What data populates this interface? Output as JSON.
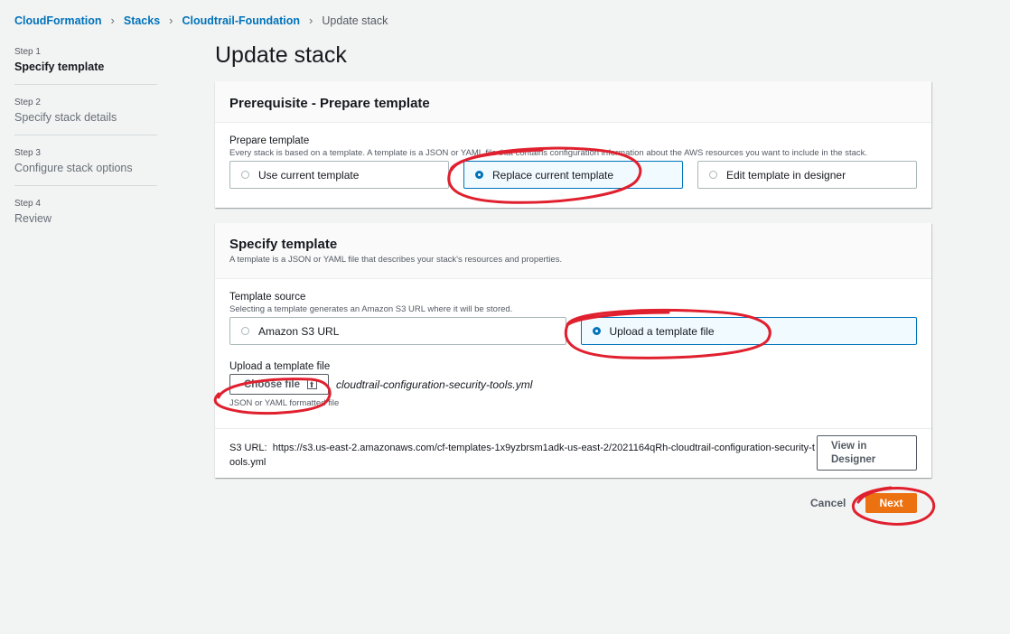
{
  "breadcrumb": {
    "items": [
      "CloudFormation",
      "Stacks",
      "Cloudtrail-Foundation"
    ],
    "current": "Update stack"
  },
  "steps": [
    {
      "num": "Step 1",
      "label": "Specify template"
    },
    {
      "num": "Step 2",
      "label": "Specify stack details"
    },
    {
      "num": "Step 3",
      "label": "Configure stack options"
    },
    {
      "num": "Step 4",
      "label": "Review"
    }
  ],
  "page_title": "Update stack",
  "prereq": {
    "title": "Prerequisite - Prepare template",
    "field_label": "Prepare template",
    "field_desc": "Every stack is based on a template. A template is a JSON or YAML file that contains configuration information about the AWS resources you want to include in the stack.",
    "options": [
      "Use current template",
      "Replace current template",
      "Edit template in designer"
    ],
    "selected": "Replace current template"
  },
  "specify": {
    "title": "Specify template",
    "desc": "A template is a JSON or YAML file that describes your stack's resources and properties.",
    "source_label": "Template source",
    "source_desc": "Selecting a template generates an Amazon S3 URL where it will be stored.",
    "source_options": [
      "Amazon S3 URL",
      "Upload a template file"
    ],
    "source_selected": "Upload a template file",
    "upload_label": "Upload a template file",
    "choose_file_label": "Choose file",
    "filename": "cloudtrail-configuration-security-tools.yml",
    "upload_hint": "JSON or YAML formatted file",
    "s3_label": "S3 URL:",
    "s3_url": "https://s3.us-east-2.amazonaws.com/cf-templates-1x9yzbrsm1adk-us-east-2/2021164qRh-cloudtrail-configuration-security-tools.yml",
    "view_designer_label": "View in Designer"
  },
  "actions": {
    "cancel": "Cancel",
    "next": "Next"
  },
  "colors": {
    "link": "#0073bb",
    "primary_button": "#ec7211",
    "selected_tile_border": "#0073bb",
    "annotation": "#e0202e"
  },
  "icons": {
    "choose_file": "upload-icon"
  }
}
